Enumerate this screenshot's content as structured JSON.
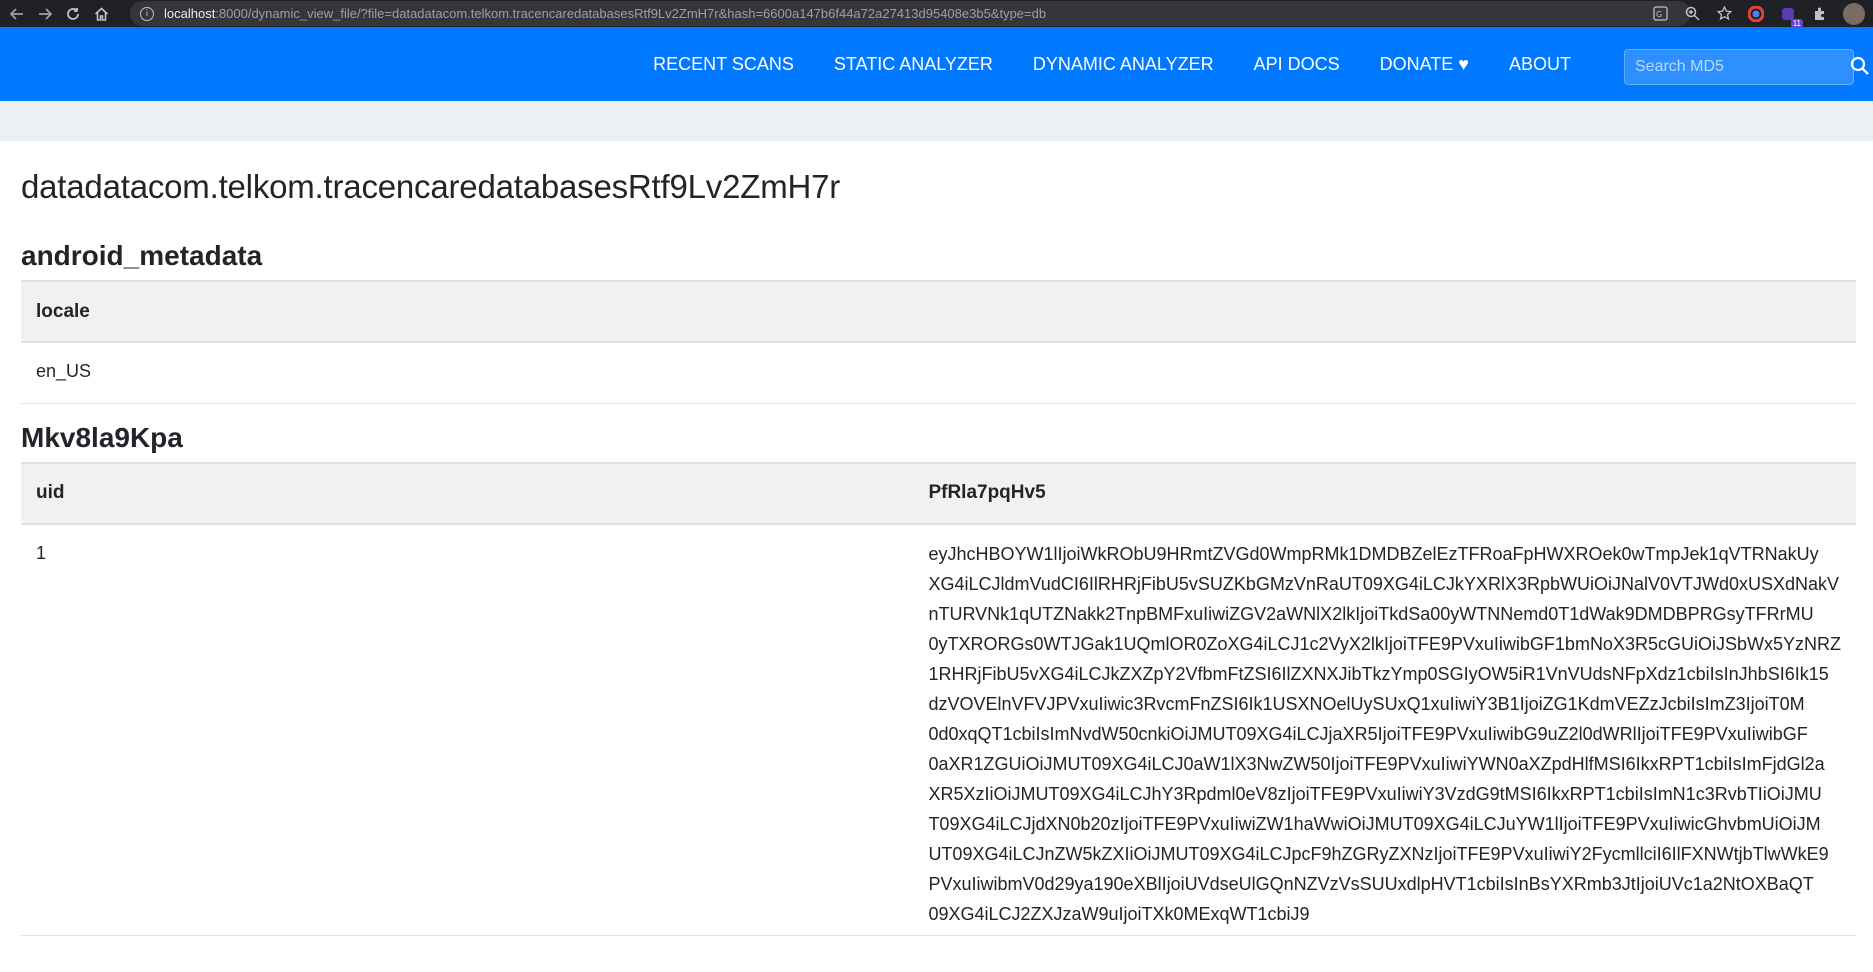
{
  "browser": {
    "url_host": "localhost",
    "url_rest": ":8000/dynamic_view_file/?file=datadatacom.telkom.tracencaredatabasesRtf9Lv2ZmH7r&hash=6600a147b6f44a72a27413d95408e3b5&type=db",
    "extension_badge": "11"
  },
  "navbar": {
    "links": [
      "RECENT SCANS",
      "STATIC ANALYZER",
      "DYNAMIC ANALYZER",
      "API DOCS",
      "DONATE ♥",
      "ABOUT"
    ],
    "search_placeholder": "Search MD5"
  },
  "page": {
    "file_title": "datadatacom.telkom.tracencaredatabasesRtf9Lv2ZmH7r"
  },
  "tables": [
    {
      "name": "android_metadata",
      "columns": [
        "locale"
      ],
      "rows": [
        [
          "en_US"
        ]
      ]
    },
    {
      "name": "Mkv8la9Kpa",
      "columns": [
        "uid",
        "PfRla7pqHv5"
      ],
      "rows": [
        {
          "uid": "1",
          "value_lines": [
            "eyJhcHBOYW1lIjoiWkRObU9HRmtZVGd0WmpRMk1DMDBZelEzTFRoaFpHWXROek0wTmpJek1qVTRNakUy",
            "XG4iLCJldmVudCI6IlRHRjFibU5vSUZKbGMzVnRaUT09XG4iLCJkYXRlX3RpbWUiOiJNalV0VTJWd0xUSXdNakV",
            "nTURVNk1qUTZNakk2TnpBMFxuIiwiZGV2aWNlX2lkIjoiTkdSa00yWTNNemd0T1dWak9DMDBPRGsyTFRrMU",
            "0yTXRORGs0WTJGak1UQmlOR0ZoXG4iLCJ1c2VyX2lkIjoiTFE9PVxuIiwibGF1bmNoX3R5cGUiOiJSbWx5YzNRZ",
            "1RHRjFibU5vXG4iLCJkZXZpY2VfbmFtZSI6IlZXNXJibTkzYmp0SGIyOW5iR1VnVUdsNFpXdz1cbiIsInJhbSI6Ik15",
            "dzVOVElnVFVJPVxuIiwic3RvcmFnZSI6Ik1USXNOelUySUxQ1xuIiwiY3B1IjoiZG1KdmVEZzJcbiIsImZ3IjoiT0M",
            "0d0xqQT1cbiIsImNvdW50cnkiOiJMUT09XG4iLCJjaXR5IjoiTFE9PVxuIiwibG9uZ2l0dWRlIjoiTFE9PVxuIiwibGF",
            "0aXR1ZGUiOiJMUT09XG4iLCJ0aW1lX3NwZW50IjoiTFE9PVxuIiwiYWN0aXZpdHlfMSI6IkxRPT1cbiIsImFjdGl2a",
            "XR5XzIiOiJMUT09XG4iLCJhY3Rpdml0eV8zIjoiTFE9PVxuIiwiY3VzdG9tMSI6IkxRPT1cbiIsImN1c3RvbTIiOiJMU",
            "T09XG4iLCJjdXN0b20zIjoiTFE9PVxuIiwiZW1haWwiOiJMUT09XG4iLCJuYW1lIjoiTFE9PVxuIiwicGhvbmUiOiJM",
            "UT09XG4iLCJnZW5kZXIiOiJMUT09XG4iLCJpcF9hZGRyZXNzIjoiTFE9PVxuIiwiY2FycmllciI6IlFXNWtjbTlwWkE9",
            "PVxuIiwibmV0d29ya190eXBlIjoiUVdseUlGQnNZVzVsSUUxdlpHVT1cbiIsInBsYXRmb3JtIjoiUVc1a2NtOXBaQT",
            "09XG4iLCJ2ZXJzaW9uIjoiTXk0MExqWT1cbiJ9"
          ]
        }
      ]
    }
  ]
}
